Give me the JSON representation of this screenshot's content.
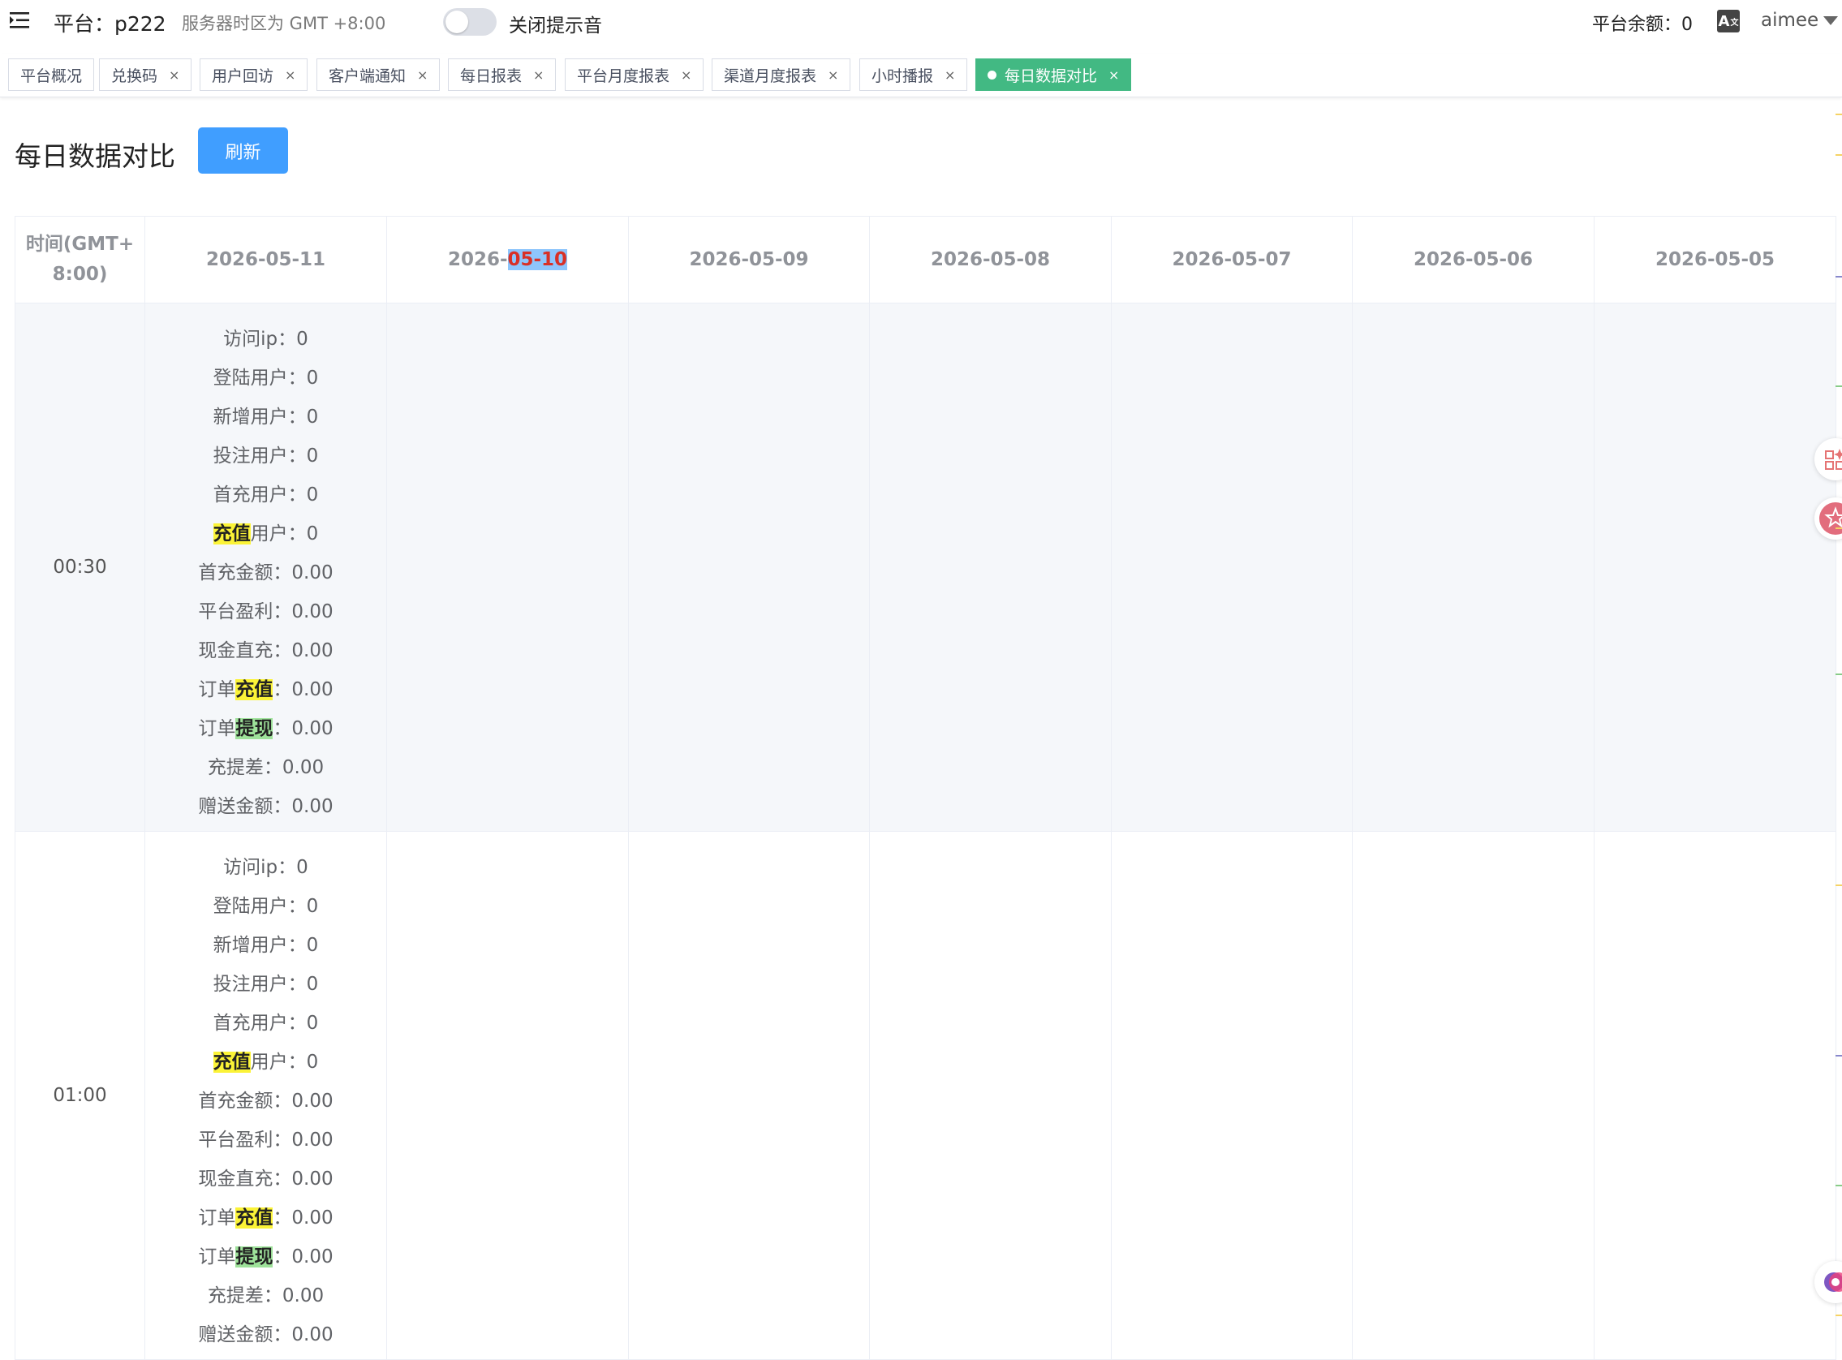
{
  "header": {
    "platform_label": "平台：p222",
    "timezone": "服务器时区为 GMT +8:00",
    "sound_switch_label": "关闭提示音",
    "balance": "平台余额：0",
    "user": "aimee",
    "icons": [
      "menu-toggle-icon",
      "translate-icon",
      "caret-down-icon"
    ]
  },
  "tabs": [
    {
      "label": "平台概况",
      "closable": false
    },
    {
      "label": "兑换码",
      "closable": true
    },
    {
      "label": "用户回访",
      "closable": true
    },
    {
      "label": "客户端通知",
      "closable": true
    },
    {
      "label": "每日报表",
      "closable": true
    },
    {
      "label": "平台月度报表",
      "closable": true
    },
    {
      "label": "渠道月度报表",
      "closable": true
    },
    {
      "label": "小时播报",
      "closable": true
    },
    {
      "label": "每日数据对比",
      "closable": true,
      "active": true
    }
  ],
  "tab_close_glyph": "×",
  "page": {
    "title": "每日数据对比",
    "refresh_label": "刷新"
  },
  "table": {
    "time_header": "时间(GMT+8:00)",
    "time_header_line1": "时间(GMT+",
    "time_header_line2": "8:00)",
    "date_columns": [
      "2026-05-11",
      "2026-05-10",
      "2026-05-09",
      "2026-05-08",
      "2026-05-07",
      "2026-05-06",
      "2026-05-05"
    ],
    "selected_text_parts": {
      "prefix": "2026-",
      "selected": "05-10"
    },
    "rows": [
      {
        "time": "00:30",
        "stats": [
          {
            "pre": "",
            "hl": "",
            "post": "访问ip",
            "value": "0"
          },
          {
            "pre": "",
            "hl": "",
            "post": "登陆用户",
            "value": "0"
          },
          {
            "pre": "",
            "hl": "",
            "post": "新增用户",
            "value": "0"
          },
          {
            "pre": "",
            "hl": "",
            "post": "投注用户",
            "value": "0"
          },
          {
            "pre": "",
            "hl": "",
            "post": "首充用户",
            "value": "0"
          },
          {
            "pre": "",
            "hl": "充值",
            "hl_color": "yellow",
            "post": "用户",
            "value": "0"
          },
          {
            "pre": "",
            "hl": "",
            "post": "首充金额",
            "value": "0.00"
          },
          {
            "pre": "",
            "hl": "",
            "post": "平台盈利",
            "value": "0.00"
          },
          {
            "pre": "",
            "hl": "",
            "post": "现金直充",
            "value": "0.00"
          },
          {
            "pre": "订单",
            "hl": "充值",
            "hl_color": "yellow",
            "post": "",
            "value": "0.00"
          },
          {
            "pre": "订单",
            "hl": "提现",
            "hl_color": "green",
            "post": "",
            "value": "0.00"
          },
          {
            "pre": "",
            "hl": "",
            "post": "充提差",
            "value": "0.00"
          },
          {
            "pre": "",
            "hl": "",
            "post": "赠送金额",
            "value": "0.00"
          }
        ]
      },
      {
        "time": "01:00",
        "stats": [
          {
            "pre": "",
            "hl": "",
            "post": "访问ip",
            "value": "0"
          },
          {
            "pre": "",
            "hl": "",
            "post": "登陆用户",
            "value": "0"
          },
          {
            "pre": "",
            "hl": "",
            "post": "新增用户",
            "value": "0"
          },
          {
            "pre": "",
            "hl": "",
            "post": "投注用户",
            "value": "0"
          },
          {
            "pre": "",
            "hl": "",
            "post": "首充用户",
            "value": "0"
          },
          {
            "pre": "",
            "hl": "充值",
            "hl_color": "yellow",
            "post": "用户",
            "value": "0"
          },
          {
            "pre": "",
            "hl": "",
            "post": "首充金额",
            "value": "0.00"
          },
          {
            "pre": "",
            "hl": "",
            "post": "平台盈利",
            "value": "0.00"
          },
          {
            "pre": "",
            "hl": "",
            "post": "现金直充",
            "value": "0.00"
          },
          {
            "pre": "订单",
            "hl": "充值",
            "hl_color": "yellow",
            "post": "",
            "value": "0.00"
          },
          {
            "pre": "订单",
            "hl": "提现",
            "hl_color": "green",
            "post": "",
            "value": "0.00"
          },
          {
            "pre": "",
            "hl": "",
            "post": "充提差",
            "value": "0.00"
          },
          {
            "pre": "",
            "hl": "",
            "post": "赠送金额",
            "value": "0.00"
          }
        ]
      }
    ]
  },
  "colors": {
    "primary_button": "#409eff",
    "active_tab": "#42b983",
    "highlight_yellow": "#fbf337",
    "highlight_green": "#9ee29a",
    "text_selection": "#8ec5fc",
    "selected_text": "#d93026"
  }
}
